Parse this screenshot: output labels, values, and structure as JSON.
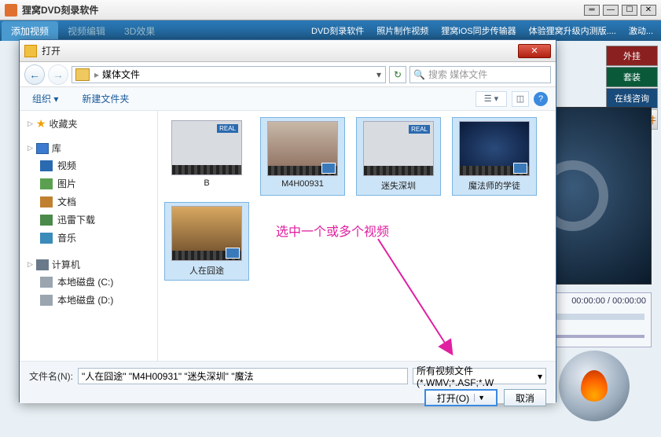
{
  "app": {
    "title": "狸窝DVD刻录软件"
  },
  "winbtns": {
    "dash": "═",
    "min": "—",
    "max": "☐",
    "close": "✕"
  },
  "menubar": {
    "tabs": [
      {
        "label": "添加视频",
        "active": true
      },
      {
        "label": "视频编辑",
        "dim": true
      },
      {
        "label": "3D效果",
        "dim": true
      }
    ],
    "links": [
      "DVD刻录软件",
      "照片制作视频",
      "狸窝iOS同步传输器",
      "体验狸窝升级内测版....",
      "激动..."
    ]
  },
  "side": {
    "a": "外挂",
    "b": "套装",
    "c": "在线咨询",
    "d": "分享软件"
  },
  "timeline": {
    "time": "00:00:00 / 00:00:00"
  },
  "dialog": {
    "title": "打开",
    "path": "媒体文件",
    "search_ph": "搜索 媒体文件",
    "toolbar": {
      "org": "组织 ▾",
      "newf": "新建文件夹"
    },
    "sidebar": {
      "fav": "收藏夹",
      "lib": "库",
      "lib_items": [
        "视频",
        "图片",
        "文档",
        "迅雷下载",
        "音乐"
      ],
      "comp": "计算机",
      "comp_items": [
        "本地磁盘 (C:)",
        "本地磁盘 (D:)"
      ]
    },
    "files": [
      {
        "name": "B",
        "type": "real",
        "checked": false
      },
      {
        "name": "M4H00931",
        "type": "thumb1",
        "checked": true,
        "sel": true
      },
      {
        "name": "迷失深圳",
        "type": "real",
        "checked": true,
        "sel": true
      },
      {
        "name": "魔法师的学徒",
        "type": "thumb2",
        "checked": true,
        "sel": true
      },
      {
        "name": "人在囧途",
        "type": "thumb3",
        "checked": true,
        "sel": true
      }
    ],
    "annotation": "选中一个或多个视频",
    "footer": {
      "fn_label": "文件名(N):",
      "fn_value": "\"人在囧途\" \"M4H00931\" \"迷失深圳\" \"魔法",
      "filter": "所有视频文件(*.WMV;*.ASF;*.W",
      "open": "打开(O)",
      "cancel": "取消"
    }
  }
}
